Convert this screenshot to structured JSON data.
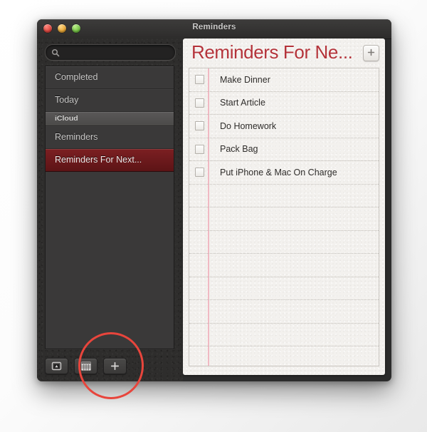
{
  "window": {
    "title": "Reminders",
    "traffic_lights": [
      {
        "name": "close-button",
        "color": "#e04a42"
      },
      {
        "name": "minimize-button",
        "color": "#e9a93a"
      },
      {
        "name": "zoom-button",
        "color": "#79c54a"
      }
    ]
  },
  "sidebar": {
    "search": {
      "value": "",
      "placeholder": "",
      "icon": "search-icon"
    },
    "items": [
      {
        "label": "Completed",
        "type": "item",
        "selected": false
      },
      {
        "label": "Today",
        "type": "item",
        "selected": false
      },
      {
        "label": "iCloud",
        "type": "group",
        "selected": false
      },
      {
        "label": "Reminders",
        "type": "item",
        "selected": false
      },
      {
        "label": "Reminders For Next...",
        "type": "item",
        "selected": true
      }
    ],
    "toolbar": [
      {
        "name": "show-calendar-sidebar-button",
        "icon": "box-arrow-up-icon",
        "label": ""
      },
      {
        "name": "calendar-view-button",
        "icon": "calendar-grid-icon",
        "label": ""
      },
      {
        "name": "add-list-button",
        "icon": "plus-icon",
        "label": "+"
      }
    ]
  },
  "detail": {
    "list_title": "Reminders For Ne...",
    "add_button": {
      "name": "add-reminder-button",
      "label": "+"
    },
    "reminders": [
      {
        "text": "Make Dinner",
        "checked": false
      },
      {
        "text": "Start Article",
        "checked": false
      },
      {
        "text": "Do Homework",
        "checked": false
      },
      {
        "text": "Pack Bag",
        "checked": false
      },
      {
        "text": "Put iPhone & Mac On Charge",
        "checked": false
      }
    ],
    "blank_rows": 8
  },
  "annotation": {
    "shape": "circle",
    "color": "#e8453c",
    "target": "add-list-button"
  },
  "colors": {
    "accent_red": "#b4333a",
    "selection_red": "#6b191b",
    "annotation_red": "#e8453c",
    "paper": "#f3f1ee",
    "sidebar_dark": "#3a3939",
    "chrome_dark": "#2e2d2c"
  }
}
